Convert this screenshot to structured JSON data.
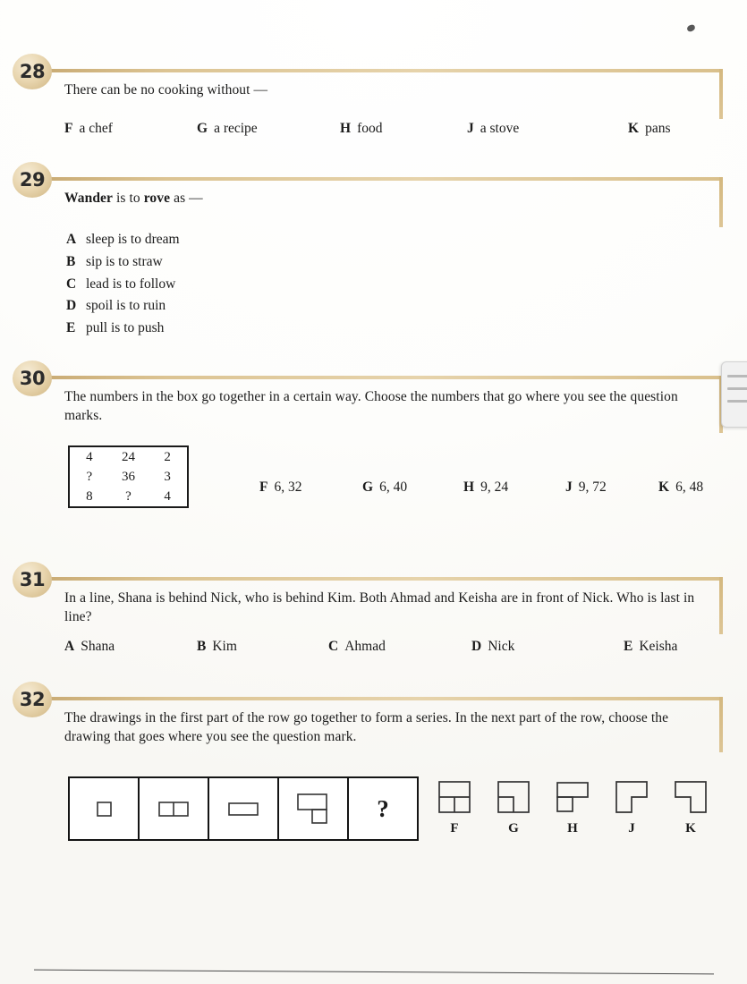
{
  "page": {
    "background_color": "#ffffff",
    "rule_color": "#d9c08c",
    "badge_color": "#e0cba0",
    "ink_color": "#1b1b1b"
  },
  "questions": [
    {
      "number": "28",
      "stem": "There can be no cooking without —",
      "layout": "horizontal",
      "choices": [
        {
          "letter": "F",
          "text": "a chef"
        },
        {
          "letter": "G",
          "text": "a recipe"
        },
        {
          "letter": "H",
          "text": "food"
        },
        {
          "letter": "J",
          "text": "a stove"
        },
        {
          "letter": "K",
          "text": "pans"
        }
      ]
    },
    {
      "number": "29",
      "stem_parts": [
        {
          "text": "Wander",
          "bold": true
        },
        {
          "text": " is to ",
          "bold": false
        },
        {
          "text": "rove",
          "bold": true
        },
        {
          "text": " as —",
          "bold": false
        }
      ],
      "layout": "vertical",
      "choices": [
        {
          "letter": "A",
          "text": "sleep is to dream"
        },
        {
          "letter": "B",
          "text": "sip is to straw"
        },
        {
          "letter": "C",
          "text": "lead is to follow"
        },
        {
          "letter": "D",
          "text": "spoil is to ruin"
        },
        {
          "letter": "E",
          "text": "pull is to push"
        }
      ]
    },
    {
      "number": "30",
      "stem": "The numbers in the box go together in a certain way. Choose the numbers that go where you see the question marks.",
      "layout": "horizontal",
      "number_grid": [
        [
          "4",
          "24",
          "2"
        ],
        [
          "?",
          "36",
          "3"
        ],
        [
          "8",
          "?",
          "4"
        ]
      ],
      "choices": [
        {
          "letter": "F",
          "text": "6, 32"
        },
        {
          "letter": "G",
          "text": "6, 40"
        },
        {
          "letter": "H",
          "text": "9, 24"
        },
        {
          "letter": "J",
          "text": "9, 72"
        },
        {
          "letter": "K",
          "text": "6, 48"
        }
      ]
    },
    {
      "number": "31",
      "stem": "In a line, Shana is behind Nick, who is behind Kim. Both Ahmad and Keisha are in front of Nick. Who is last in line?",
      "layout": "horizontal",
      "choices": [
        {
          "letter": "A",
          "text": "Shana"
        },
        {
          "letter": "B",
          "text": "Kim"
        },
        {
          "letter": "C",
          "text": "Ahmad"
        },
        {
          "letter": "D",
          "text": "Nick"
        },
        {
          "letter": "E",
          "text": "Keisha"
        }
      ]
    },
    {
      "number": "32",
      "stem": "The drawings in the first part of the row go together to form a series. In the next part of the row, choose the drawing that goes where you see the question mark.",
      "layout": "figures",
      "series": [
        {
          "shape": "small-square"
        },
        {
          "shape": "two-cell-rect"
        },
        {
          "shape": "wide-rect"
        },
        {
          "shape": "wide-rect-with-square-below-right"
        },
        {
          "shape": "question-mark",
          "label": "?"
        }
      ],
      "figure_choices": [
        {
          "letter": "F",
          "shape": "square-top-band-two-bottom-cells"
        },
        {
          "letter": "G",
          "shape": "square-with-small-square-bottom-left"
        },
        {
          "letter": "H",
          "shape": "wide-rect-with-square-below-left"
        },
        {
          "letter": "J",
          "shape": "l-shape-notch-bottom-right"
        },
        {
          "letter": "K",
          "shape": "l-shape-notch-bottom-left"
        }
      ]
    }
  ],
  "side_tab": {
    "icon": "hamburger-menu-icon",
    "lines": 3
  }
}
